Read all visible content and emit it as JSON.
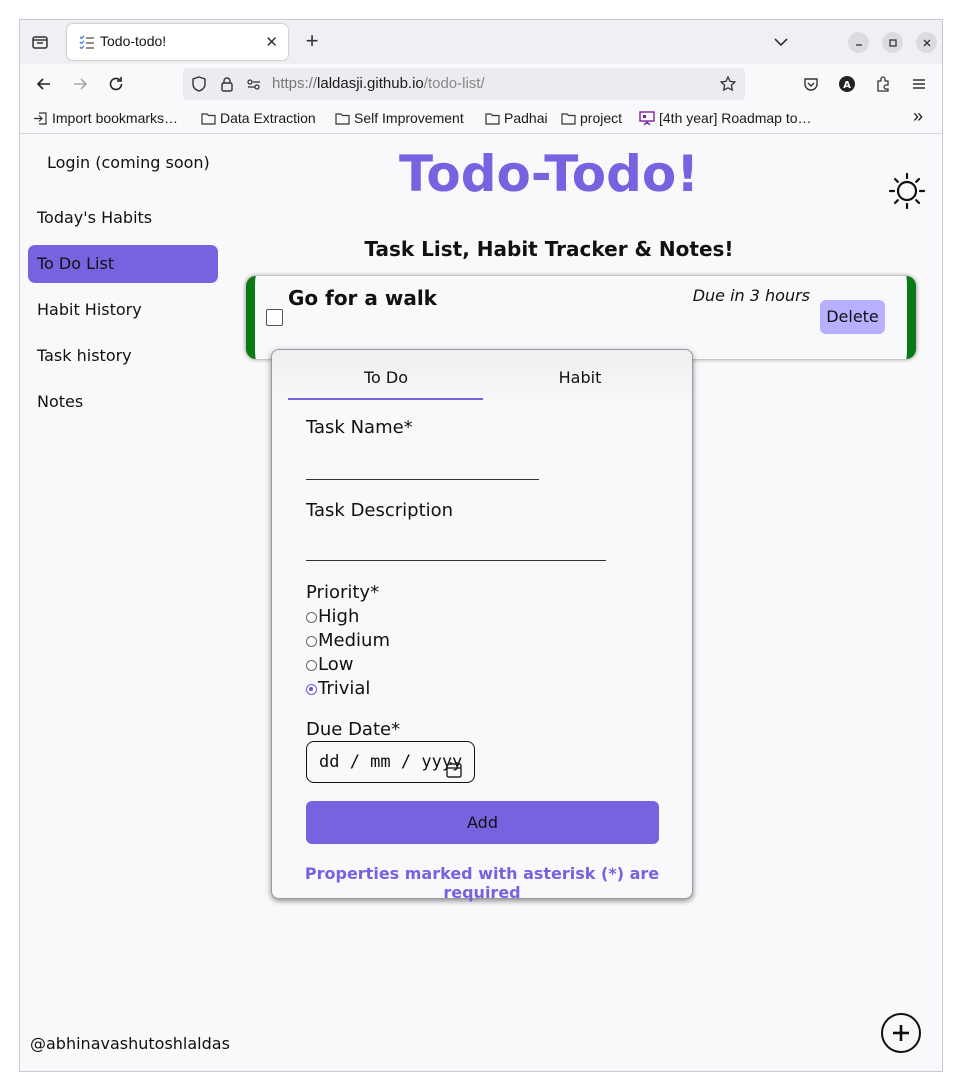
{
  "browser": {
    "tab_title": "Todo-todo!",
    "tab_close": "✕",
    "new_tab": "+",
    "url_scheme": "https://",
    "url_host": "laldasji.github.io",
    "url_path": "/todo-list/",
    "bookmarks": [
      {
        "label": "Import bookmarks…",
        "icon": "import-icon"
      },
      {
        "label": "Data Extraction",
        "icon": "folder-icon"
      },
      {
        "label": "Self Improvement",
        "icon": "folder-icon"
      },
      {
        "label": "Padhai",
        "icon": "folder-icon"
      },
      {
        "label": "project",
        "icon": "folder-icon"
      },
      {
        "label": "[4th year] Roadmap to…",
        "icon": "presentation-icon"
      }
    ],
    "bookmarks_overflow": "»"
  },
  "sidebar": {
    "login": "Login (coming soon)",
    "items": [
      {
        "label": "Today's Habits",
        "active": false
      },
      {
        "label": "To Do List",
        "active": true
      },
      {
        "label": "Habit History",
        "active": false
      },
      {
        "label": "Task history",
        "active": false
      },
      {
        "label": "Notes",
        "active": false
      }
    ],
    "footer_user": "@abhinavashutoshlaldas"
  },
  "header": {
    "title": "Todo-Todo!",
    "subtitle": "Task List, Habit Tracker & Notes!"
  },
  "task": {
    "title": "Go for a walk",
    "due": "Due in 3 hours",
    "delete_label": "Delete",
    "border_color": "#0a7a14"
  },
  "modal": {
    "tabs": [
      "To Do",
      "Habit"
    ],
    "active_tab": "To Do",
    "task_name_label": "Task Name*",
    "task_description_label": "Task Description",
    "priority_label": "Priority*",
    "priorities": [
      "High",
      "Medium",
      "Low",
      "Trivial"
    ],
    "selected_priority": "Trivial",
    "due_date_label": "Due Date*",
    "due_date_placeholder": "dd / mm / yyyy",
    "add_label": "Add",
    "required_note": "Properties marked with asterisk (*) are required"
  },
  "colors": {
    "accent": "#7763e0",
    "delete_button": "#b7afff"
  }
}
